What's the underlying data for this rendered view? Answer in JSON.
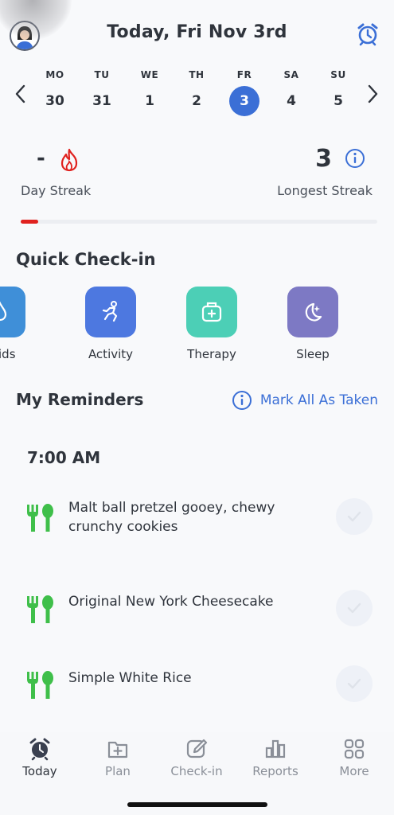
{
  "header": {
    "title": "Today, Fri Nov 3rd"
  },
  "week": {
    "days": [
      {
        "abbr": "MO",
        "num": "30"
      },
      {
        "abbr": "TU",
        "num": "31"
      },
      {
        "abbr": "WE",
        "num": "1"
      },
      {
        "abbr": "TH",
        "num": "2"
      },
      {
        "abbr": "FR",
        "num": "3",
        "selected": true
      },
      {
        "abbr": "SA",
        "num": "4"
      },
      {
        "abbr": "SU",
        "num": "5"
      }
    ]
  },
  "streak": {
    "day_streak_value": "-",
    "day_streak_label": "Day Streak",
    "longest_value": "3",
    "longest_label": "Longest Streak",
    "progress_fraction": 0.05
  },
  "quick_checkin": {
    "title": "Quick Check-in",
    "items": [
      {
        "label": "ids",
        "icon": "fluids-icon",
        "color": "#3f8fd8"
      },
      {
        "label": "Activity",
        "icon": "activity-icon",
        "color": "#4d78e0"
      },
      {
        "label": "Therapy",
        "icon": "therapy-icon",
        "color": "#4ccfb6"
      },
      {
        "label": "Sleep",
        "icon": "sleep-icon",
        "color": "#7d79c4"
      }
    ]
  },
  "reminders": {
    "title": "My Reminders",
    "mark_all": "Mark All As Taken",
    "time": "7:00 AM",
    "items": [
      {
        "name": "Malt ball pretzel gooey, chewy crunchy cookies",
        "icon": "fork-spoon-icon"
      },
      {
        "name": "Original New York Cheesecake",
        "icon": "fork-spoon-icon"
      },
      {
        "name": "Simple White Rice",
        "icon": "fork-spoon-icon"
      }
    ]
  },
  "tabs": [
    {
      "label": "Today",
      "icon": "alarm-clock-icon",
      "active": true
    },
    {
      "label": "Plan",
      "icon": "plan-icon"
    },
    {
      "label": "Check-in",
      "icon": "edit-icon"
    },
    {
      "label": "Reports",
      "icon": "chart-icon"
    },
    {
      "label": "More",
      "icon": "grid-icon"
    }
  ],
  "colors": {
    "accent": "#3b6fd6",
    "streak_red": "#e0221f",
    "food_green": "#3fbf4a"
  }
}
